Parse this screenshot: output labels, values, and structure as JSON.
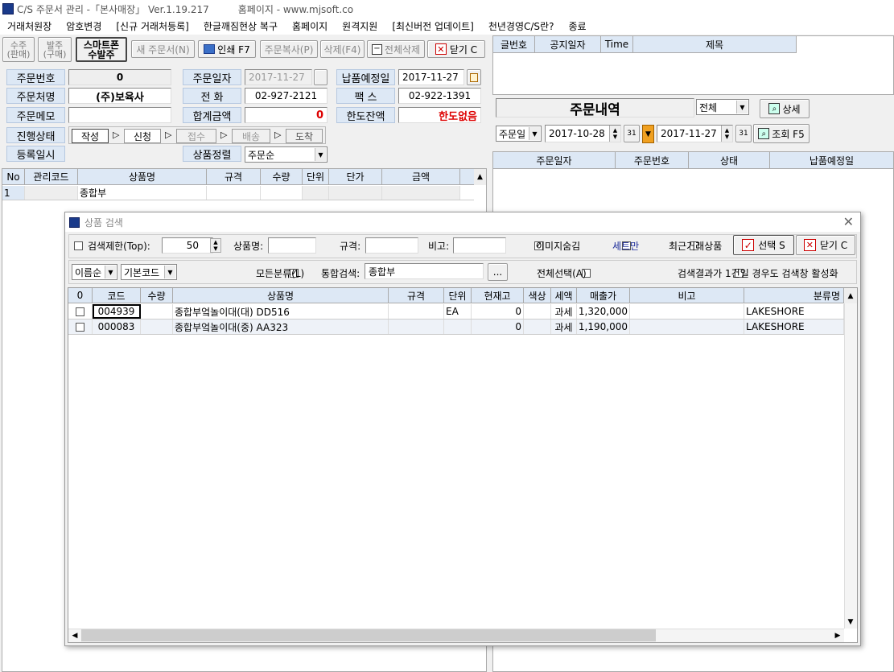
{
  "app": {
    "title": "C/S 주문서 관리 -「본사매장」 Ver.1.19.217",
    "homepage": "홈페이지 - www.mjsoft.co"
  },
  "menu": [
    "거래처원장",
    "암호변경",
    "[신규 거래처등록]",
    "한글깨짐현상 복구",
    "홈페이지",
    "원격지원",
    "[최신버전 업데이트]",
    "천년경영C/S란?",
    "종료"
  ],
  "toolbar": {
    "sale": "수주\n(판매)",
    "buy": "발주\n(구매)",
    "smart": "스마트폰\n수발주",
    "new": "새 주문서(N)",
    "print": "인쇄 F7",
    "copy": "주문복사(P)",
    "delete": "삭제(F4)",
    "delete_all": "전체삭제",
    "close": "닫기 C"
  },
  "form": {
    "order_no_label": "주문번호",
    "order_no": "0",
    "order_date_label": "주문일자",
    "order_date": "2017-11-27",
    "delivery_label": "납품예정일",
    "delivery_date": "2017-11-27",
    "customer_label": "주문처명",
    "customer": "(주)보육사",
    "phone_label": "전 화",
    "phone": "02-927-2121",
    "fax_label": "팩 스",
    "fax": "02-922-1391",
    "memo_label": "주문메모",
    "memo": "",
    "total_label": "합계금액",
    "total": "0",
    "limit_label": "한도잔액",
    "limit": "한도없음",
    "status_label": "진행상태",
    "steps": [
      "작성",
      "신청",
      "접수",
      "배송",
      "도착"
    ],
    "reg_label": "등록일시",
    "sort_label": "상품정렬",
    "sort": "주문순"
  },
  "order_grid": {
    "columns": [
      "No",
      "관리코드",
      "상품명",
      "규격",
      "수량",
      "단위",
      "단가",
      "금액"
    ],
    "rows": [
      [
        "1",
        "",
        "종합부",
        "",
        "",
        "",
        "",
        ""
      ]
    ]
  },
  "right": {
    "cols": [
      "글번호",
      "공지일자",
      "Time",
      "제목"
    ],
    "order_title": "주문내역",
    "filter": "전체",
    "detail": "상세",
    "date_type": "주문일",
    "from": "2017-10-28",
    "to": "2017-11-27",
    "search": "조회 F5",
    "list_cols": [
      "주문일자",
      "주문번호",
      "상태",
      "납품예정일"
    ]
  },
  "dialog": {
    "title": "상품 검색",
    "limit_label": "검색제한(Top):",
    "limit_value": "50",
    "name_label": "상품명:",
    "name_value": "",
    "spec_label": "규격:",
    "spec_value": "",
    "memo_label": "비고:",
    "memo_value": "",
    "hide_image": "이미지숨김",
    "set_only": "세트만",
    "recent": "최근거래상품",
    "select": "선택 S",
    "close": "닫기 C",
    "sort": "이름순",
    "code_type": "기본코드",
    "all_cat": "모든분류(L)",
    "integrated_label": "통합검색:",
    "integrated_value": "종합부",
    "more": "...",
    "select_all": "전체선택(A)",
    "auto_open": "검색결과가 1건일 경우도 검색창 활성화",
    "columns": [
      "0",
      "코드",
      "수량",
      "상품명",
      "규격",
      "단위",
      "현재고",
      "색상",
      "세액",
      "매출가",
      "비고",
      "분류명"
    ],
    "rows": [
      [
        "",
        "004939",
        "",
        "종합부엌놀이대(대) DD516",
        "",
        "EA",
        "0",
        "",
        "과세",
        "1,320,000",
        "",
        "LAKESHORE"
      ],
      [
        "",
        "000083",
        "",
        "종합부엌놀이대(중) AA323",
        "",
        "",
        "0",
        "",
        "과세",
        "1,190,000",
        "",
        "LAKESHORE"
      ]
    ]
  }
}
